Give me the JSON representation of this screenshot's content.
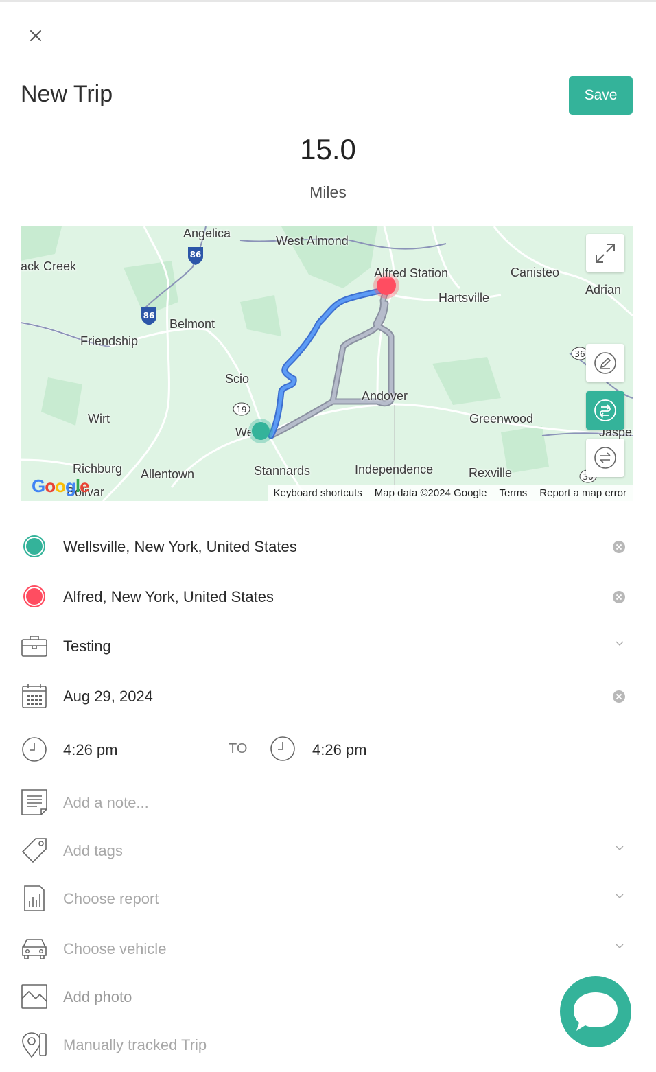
{
  "header": {
    "title": "New Trip",
    "save_label": "Save"
  },
  "trip": {
    "distance": "15.0",
    "unit": "Miles"
  },
  "map": {
    "labels": [
      "Angelica",
      "West Almond",
      "ack Creek",
      "Alfred Station",
      "Canisteo",
      "Adrian",
      "Hartsville",
      "Belmont",
      "Friendship",
      "Scio",
      "Andover",
      "Wirt",
      "Greenwood",
      "Wellsville",
      "Jaspe",
      "Richburg",
      "Allentown",
      "Stannards",
      "Independence",
      "Rexville",
      "Bolivar"
    ],
    "shields": [
      "86",
      "86",
      "19",
      "36",
      "36"
    ],
    "attribution": {
      "shortcuts": "Keyboard shortcuts",
      "data": "Map data ©2024 Google",
      "terms": "Terms",
      "report": "Report a map error"
    },
    "logo": "Google",
    "colors": {
      "route_primary": "#4a8ef0",
      "route_alt": "#a6adc0",
      "start": "#34b39a",
      "end": "#ff4d61"
    }
  },
  "form": {
    "start_location": "Wellsville, New York, United States",
    "end_location": "Alfred, New York, United States",
    "purpose": "Testing",
    "date": "Aug 29, 2024",
    "start_time": "4:26 pm",
    "to_label": "TO",
    "end_time": "4:26 pm",
    "note_placeholder": "Add a note...",
    "tags_placeholder": "Add tags",
    "report_placeholder": "Choose report",
    "vehicle_placeholder": "Choose vehicle",
    "photo_label": "Add photo",
    "tracking_label": "Manually tracked Trip"
  },
  "icons": [
    "close-icon",
    "expand-icon",
    "edit-route-icon",
    "route-icon",
    "swap-icon",
    "briefcase-icon",
    "calendar-icon",
    "clock-icon",
    "note-icon",
    "tag-icon",
    "report-icon",
    "car-icon",
    "photo-icon",
    "location-phone-icon",
    "chat-icon"
  ],
  "accent": "#34b39a"
}
